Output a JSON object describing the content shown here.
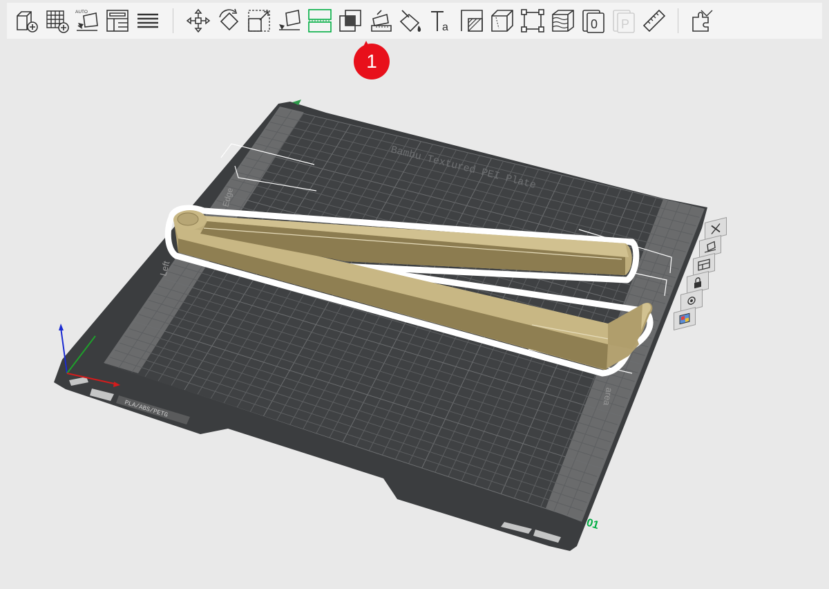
{
  "toolbar": {
    "buttons": [
      {
        "id": "add-object",
        "icon": "cube-add-icon",
        "enabled": true
      },
      {
        "id": "add-plate",
        "icon": "grid-add-icon",
        "enabled": true
      },
      {
        "id": "auto-orient",
        "icon": "auto-orient-icon",
        "label": "AUTO",
        "enabled": true
      },
      {
        "id": "arrange",
        "icon": "arrange-icon",
        "enabled": true
      },
      {
        "id": "split",
        "icon": "layers-menu-icon",
        "enabled": true
      },
      {
        "id": "move",
        "icon": "move-icon",
        "enabled": true
      },
      {
        "id": "rotate",
        "icon": "rotate-icon",
        "enabled": true
      },
      {
        "id": "scale",
        "icon": "scale-icon",
        "enabled": true
      },
      {
        "id": "lay-on-face",
        "icon": "lay-on-face-icon",
        "enabled": true
      },
      {
        "id": "cut",
        "icon": "cut-icon",
        "enabled": true,
        "active": true
      },
      {
        "id": "boolean",
        "icon": "boolean-icon",
        "enabled": true
      },
      {
        "id": "support-paint",
        "icon": "support-paint-icon",
        "enabled": true
      },
      {
        "id": "color-paint",
        "icon": "paint-bucket-icon",
        "enabled": true
      },
      {
        "id": "text",
        "icon": "text-icon",
        "label": "Ta",
        "enabled": true
      },
      {
        "id": "seam",
        "icon": "seam-paint-icon",
        "enabled": true
      },
      {
        "id": "fuzzy",
        "icon": "wireframe-cube-icon",
        "enabled": true
      },
      {
        "id": "bbox",
        "icon": "bounding-box-icon",
        "enabled": true
      },
      {
        "id": "height-range",
        "icon": "height-range-icon",
        "enabled": true
      },
      {
        "id": "variable-layer",
        "icon": "variable-layer-icon",
        "label": "0",
        "enabled": true
      },
      {
        "id": "assembly",
        "icon": "plate-p-icon",
        "label": "P",
        "enabled": false
      },
      {
        "id": "measure",
        "icon": "ruler-icon",
        "enabled": true
      },
      {
        "id": "assembly-view",
        "icon": "puzzle-icon",
        "enabled": true
      }
    ]
  },
  "marker": {
    "number": "1"
  },
  "plate": {
    "name_text": "Bambu Textured PEI Plate",
    "left_text": "Left",
    "edge_text": "Edge",
    "area_text": "area",
    "tag_text": "PLA/ABS/PETG",
    "plate_number": "01"
  },
  "side_tools": [
    {
      "id": "delete-plate",
      "icon": "close-x-icon"
    },
    {
      "id": "orient-plate",
      "icon": "orient-plate-icon"
    },
    {
      "id": "arrange-plate",
      "icon": "arrange-plate-icon"
    },
    {
      "id": "lock-plate",
      "icon": "lock-icon"
    },
    {
      "id": "plate-settings",
      "icon": "gear-icon"
    },
    {
      "id": "plate-color",
      "icon": "color-palette-icon"
    }
  ],
  "colors": {
    "plate": "#3d3f40",
    "grid": "#5a5c5e",
    "excluded": "#6b6c6d",
    "model": "#c4b381",
    "model_dark": "#8a7a4e",
    "outline": "#ffffff",
    "active_tool": "#00ae42",
    "marker": "#e8101b",
    "plate_number": "#00ae42",
    "toolbar_bg": "#f4f4f4",
    "viewport_bg": "#e9e9e9"
  }
}
